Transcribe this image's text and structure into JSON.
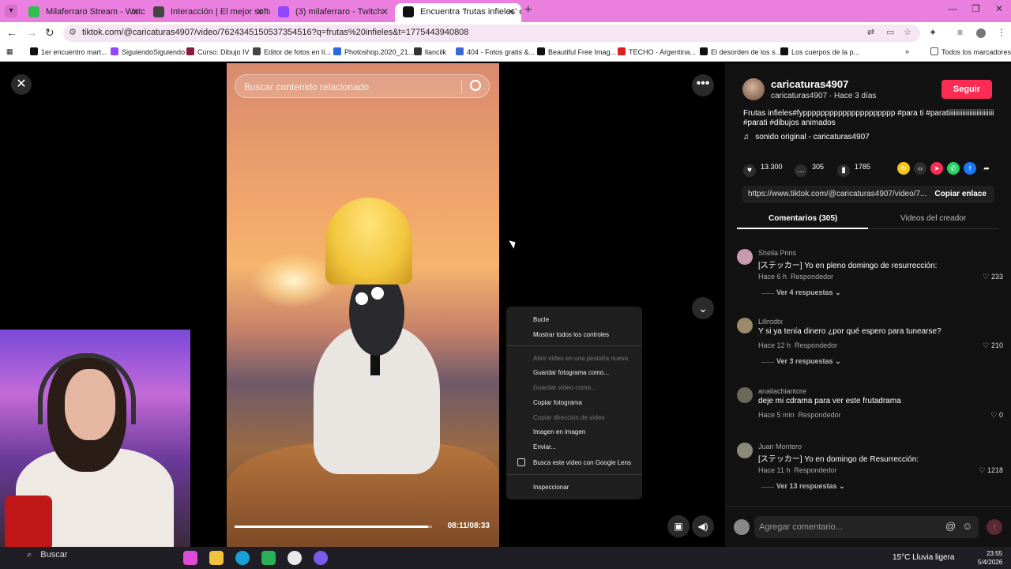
{
  "browser": {
    "tabs": [
      {
        "label": "Milaferraro Stream - Watch Liv",
        "color": "#2fbf4f"
      },
      {
        "label": "Interacción | El mejor software",
        "color": "#222222"
      },
      {
        "label": "(3) milaferraro - Twitch",
        "color": "#9146ff"
      },
      {
        "label": "Encuentra 'frutas infieles' e",
        "color": "#111111",
        "active": true
      }
    ],
    "url": "tiktok.com/@caricaturas4907/video/7624345150537354516?q=frutas%20infieles&t=1775443940808",
    "bookmarks": [
      {
        "label": "1er encuentro mart...",
        "color": "#111111"
      },
      {
        "label": "SiguiendoSiguiendo",
        "color": "#9146ff"
      },
      {
        "label": "Curso: Dibujo IV",
        "color": "#8a1a3a"
      },
      {
        "label": "Editor de fotos en lí...",
        "color": "#444444"
      },
      {
        "label": "Photoshop.2020_21...",
        "color": "#2a6ad8"
      },
      {
        "label": "llancilk",
        "color": "#333333"
      },
      {
        "label": "404 - Fotos gratis &...",
        "color": "#3a6ad8"
      },
      {
        "label": "Beautiful Free Imag...",
        "color": "#111111"
      },
      {
        "label": "TECHO - Argentina...",
        "color": "#e02020"
      },
      {
        "label": "El desorden de los s...",
        "color": "#111111"
      },
      {
        "label": "Los cuerpos de la p...",
        "color": "#111111"
      }
    ],
    "all_bookmarks": "Todos los marcadores"
  },
  "video": {
    "search_placeholder": "Buscar contenido relacionado",
    "time": "08:11/08:33",
    "progress": 0.98
  },
  "context_menu": {
    "items": [
      {
        "label": "Bucle",
        "disabled": false
      },
      {
        "label": "Mostrar todos los controles",
        "disabled": false
      },
      {
        "label": "Abrir vídeo en una pestaña nueva",
        "disabled": true
      },
      {
        "label": "Guardar fotograma como...",
        "disabled": false
      },
      {
        "label": "Guardar vídeo como...",
        "disabled": true
      },
      {
        "label": "Copiar fotograma",
        "disabled": false
      },
      {
        "label": "Copiar dirección de vídeo",
        "disabled": true
      },
      {
        "label": "Imagen en imagen",
        "disabled": false
      },
      {
        "label": "Enviar...",
        "disabled": false
      },
      {
        "label": "Busca este vídeo con Google Lens",
        "disabled": false
      },
      {
        "label": "Inspeccionar",
        "disabled": false
      }
    ]
  },
  "creator": {
    "username": "caricaturas4907",
    "subline": "caricaturas4907 · Hace 3 días",
    "follow_label": "Seguir",
    "description": "Frutas infieles#fyppppppppppppppppppppp #para ti #paratiiiiiiiiiiiiiiiiiiiiiiiiii #parati #dibujos animados",
    "sound": "sonido original - caricaturas4907"
  },
  "stats": {
    "likes": "13.300",
    "comments": "305",
    "saves": "1785"
  },
  "link": {
    "url": "https://www.tiktok.com/@caricaturas4907/video/7...",
    "copy_label": "Copiar enlace"
  },
  "panel_tabs": {
    "comments": "Comentarios (305)",
    "creator_videos": "Videos del creador"
  },
  "comments": [
    {
      "name": "Sheila Prins",
      "text": "[ステッカー] Yo en pleno domingo de resurrección:",
      "time": "Hace 6 h",
      "reply": "Respondedor",
      "likes": "233",
      "replies": "Ver 4 respuestas",
      "avatar_color": "#c89ab0"
    },
    {
      "name": "Lilirodtx",
      "text": "Y si ya tenía dinero ¿por qué espero para tunearse?",
      "time": "Hace 12 h",
      "reply": "Respondedor",
      "likes": "210",
      "replies": "Ver 3 respuestas",
      "avatar_color": "#9a8a6a"
    },
    {
      "name": "analiachiantore",
      "text": "deje mi cdrama para ver este frutadrama",
      "time": "Hace 5 min",
      "reply": "Respondedor",
      "likes": "0",
      "replies": "",
      "avatar_color": "#6a6a5a"
    },
    {
      "name": "Juan Montero",
      "text": "[ステッカー] Yo en domingo de Resurrección:",
      "time": "Hace 11 h",
      "reply": "Respondedor",
      "likes": "1218",
      "replies": "Ver 13 respuestas",
      "avatar_color": "#8a8a7a"
    }
  ],
  "add_comment": {
    "placeholder": "Agregar comentario..."
  },
  "taskbar": {
    "search": "Buscar",
    "weather": "15°C  Lluvia ligera",
    "time": "23:55",
    "date": "5/4/2026"
  }
}
